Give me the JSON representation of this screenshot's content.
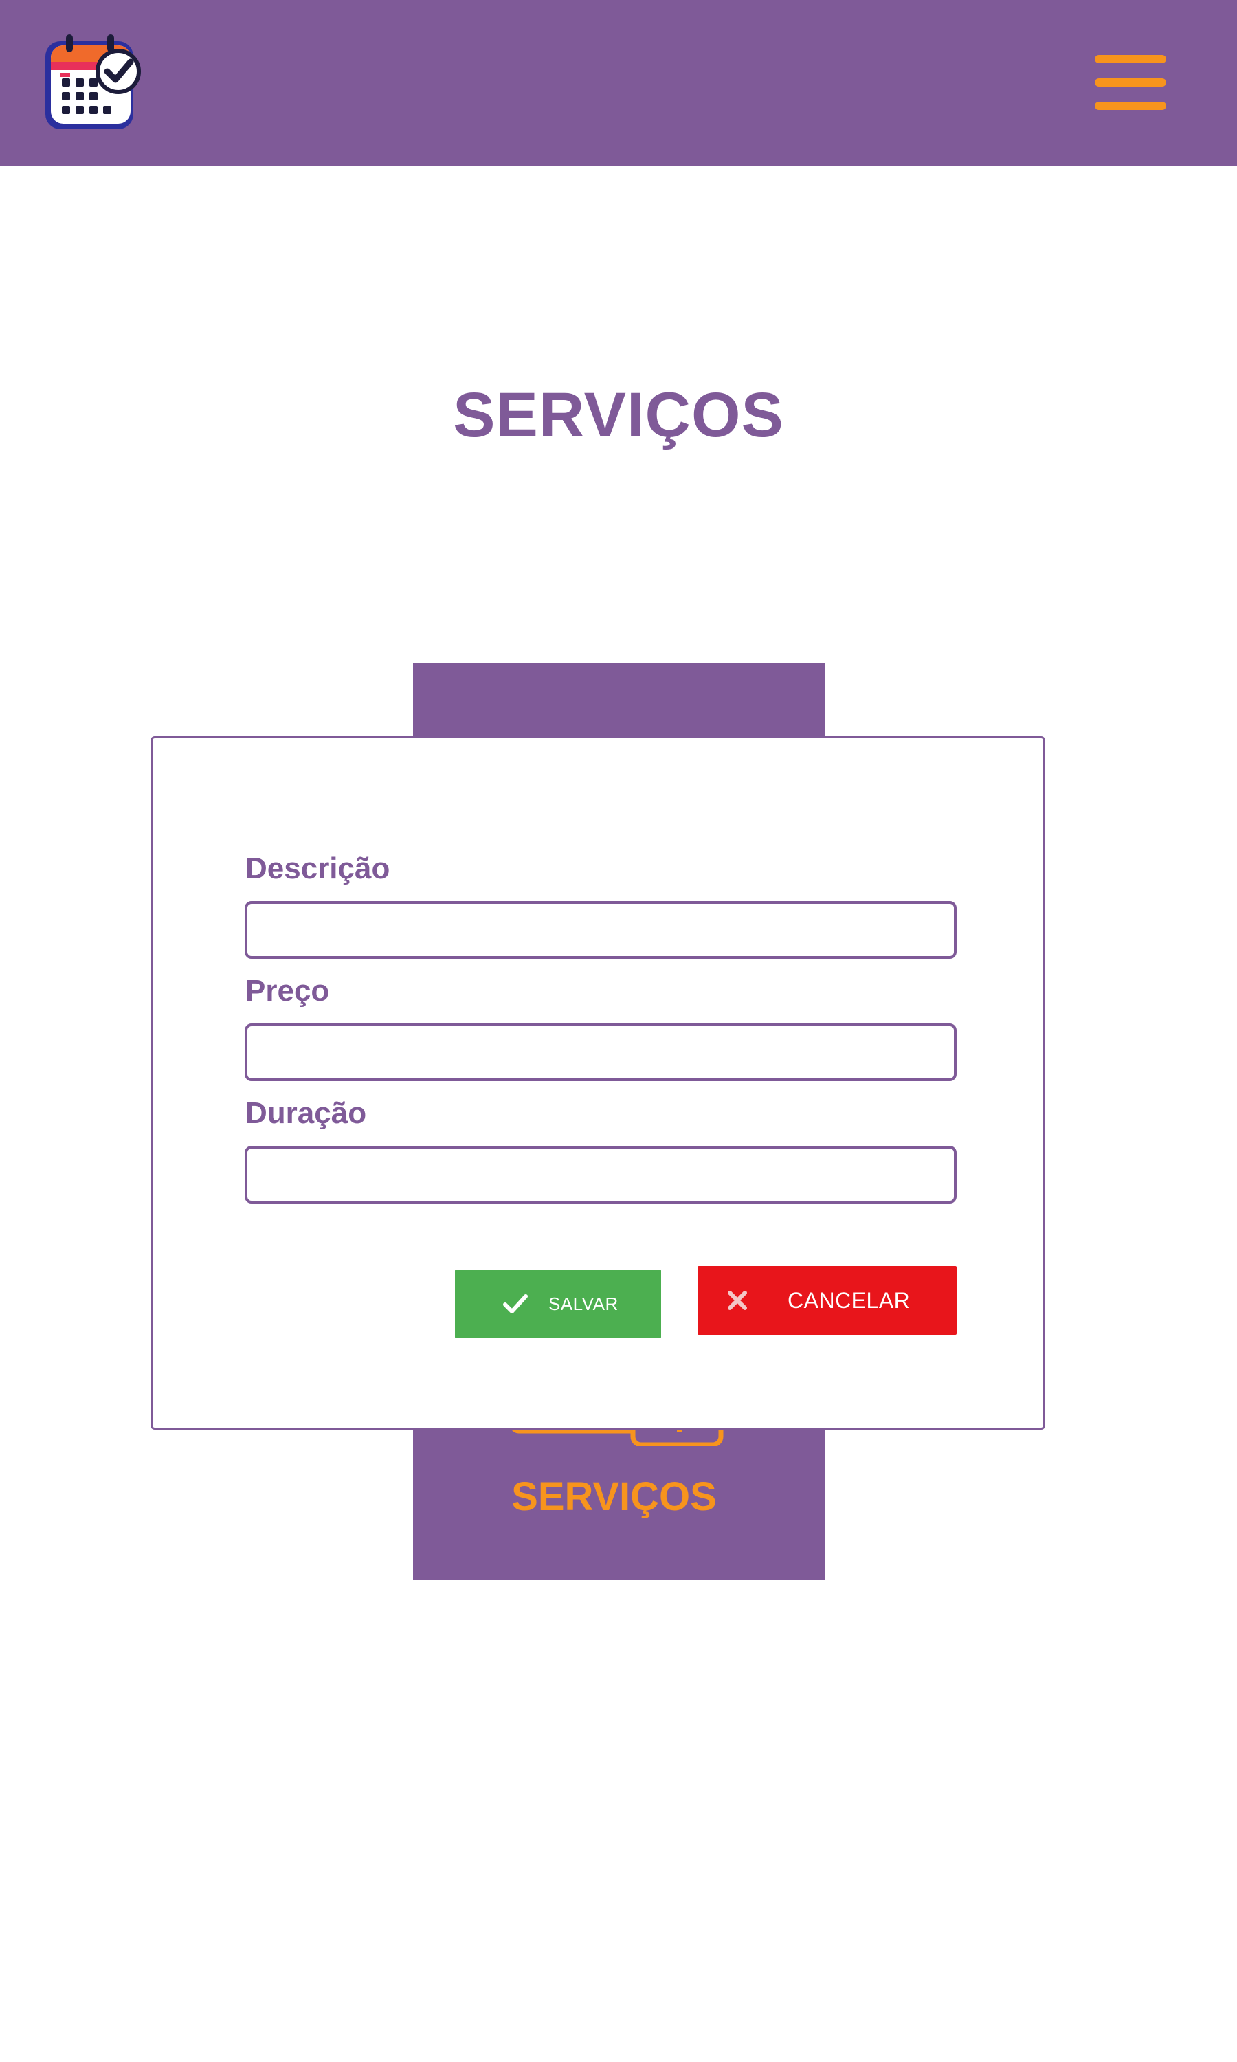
{
  "header": {
    "logo_icon": "calendar-check-icon",
    "menu_icon": "hamburger-menu-icon",
    "background_color": "#7f5a98",
    "accent_color": "#f7941d"
  },
  "page": {
    "title": "SERVIÇOS"
  },
  "background_card": {
    "label": "SERVIÇOS",
    "icon": "services-icon"
  },
  "form": {
    "fields": [
      {
        "label": "Descrição",
        "value": "",
        "placeholder": ""
      },
      {
        "label": "Preço",
        "value": "",
        "placeholder": ""
      },
      {
        "label": "Duração",
        "value": "",
        "placeholder": ""
      }
    ],
    "save_button": {
      "label": "SALVAR",
      "icon": "check-icon",
      "color": "#4caf50"
    },
    "cancel_button": {
      "label": "CANCELAR",
      "icon": "close-icon",
      "color": "#e8151b"
    }
  }
}
